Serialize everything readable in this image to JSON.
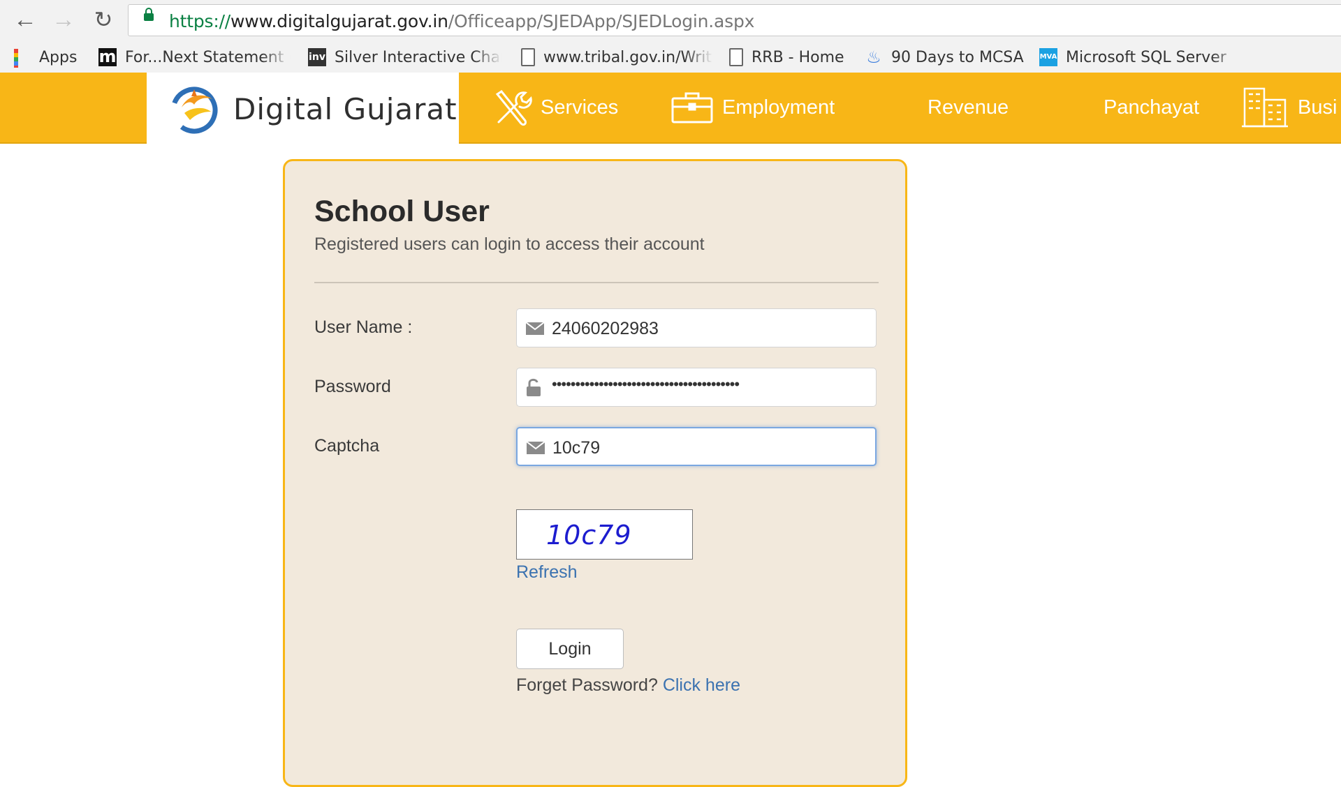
{
  "browser": {
    "url_protocol": "https://",
    "url_host": "www.digitalgujarat.gov.in",
    "url_path": "/Officeapp/SJEDApp/SJEDLogin.aspx",
    "bookmarks": [
      {
        "label": "Apps",
        "icon": "apps-grid-icon"
      },
      {
        "label": "For...Next Statement (",
        "icon": "m-logo-icon"
      },
      {
        "label": "Silver Interactive Char",
        "icon": "inv-logo-icon"
      },
      {
        "label": "www.tribal.gov.in/Writ",
        "icon": "page-icon"
      },
      {
        "label": "RRB - Home",
        "icon": "page-icon"
      },
      {
        "label": "90 Days to MCSA",
        "icon": "flame-icon"
      },
      {
        "label": "Microsoft SQL Server",
        "icon": "mva-icon"
      }
    ]
  },
  "site": {
    "brand": "Digital Gujarat",
    "accent_color": "#f8b617",
    "nav": [
      {
        "label": "Services",
        "icon": "tools-icon"
      },
      {
        "label": "Employment",
        "icon": "briefcase-icon"
      },
      {
        "label": "Revenue"
      },
      {
        "label": "Panchayat"
      },
      {
        "label": "Busi",
        "icon": "buildings-icon"
      }
    ]
  },
  "login": {
    "title": "School User",
    "subtitle": "Registered users can login to access their account",
    "username_label": "User Name :",
    "username_value": "24060202983",
    "password_label": "Password",
    "password_mask": "••••••••••••••••••••••••••••••••••••••••",
    "captcha_label": "Captcha",
    "captcha_value": "10c79",
    "captcha_image_text": "10c79",
    "refresh_link": "Refresh",
    "login_button": "Login",
    "forget_text": "Forget Password?",
    "click_here": "Click here"
  }
}
